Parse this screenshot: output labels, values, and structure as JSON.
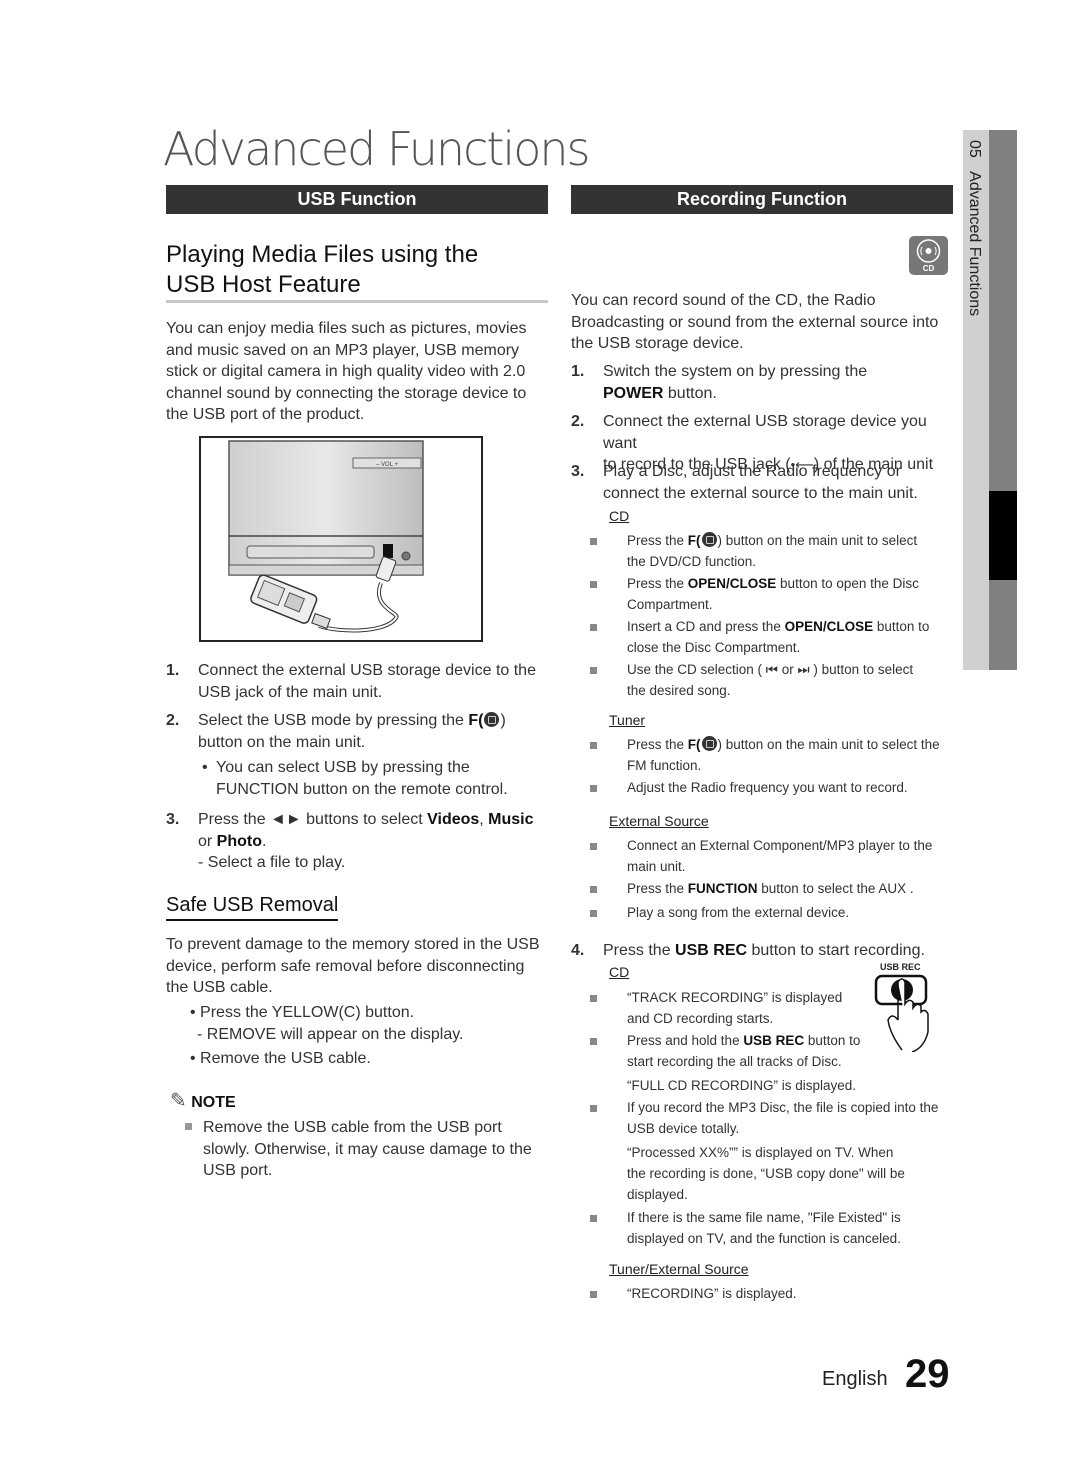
{
  "page_title": "Advanced Functions",
  "usb": {
    "section_label": "USB Function",
    "heading_line1": "Playing Media Files using the",
    "heading_line2": "USB Host Feature",
    "intro": [
      "You can enjoy media files such as pictures, movies",
      "and music saved on an MP3 player, USB memory",
      "stick or digital camera in high quality video with 2.0",
      "channel sound by connecting the storage device to",
      "the USB port of the product."
    ],
    "figure": {
      "vol_label": "–   VOL   +",
      "alt": "Main unit with USB cable connected to an MP3 player"
    },
    "steps": [
      {
        "num": "1.",
        "lines": [
          "Connect the external USB storage device to the",
          "USB jack of the main unit."
        ]
      },
      {
        "num": "2.",
        "line1_pre": "Select the USB mode by pressing the ",
        "line1_bold": "F(",
        "line1_post": ")",
        "line2": "button on the main unit."
      },
      {
        "num": "3.",
        "pre": "Press the ◄► buttons to select ",
        "b1": "Videos",
        "sep": ", ",
        "b2": "Music",
        "line2_pre": "or ",
        "b3": "Photo",
        "line2_post": ".",
        "line3": "- Select a file to play."
      }
    ],
    "step2_bullet": [
      "You can select USB by pressing the",
      "FUNCTION button on the remote control."
    ],
    "safe_removal": {
      "heading": "Safe USB Removal",
      "text": [
        "To prevent damage to the memory stored in the USB",
        "device, perform safe removal before disconnecting",
        "the USB cable."
      ],
      "bullet1": "Press  the YELLOW(C) button.",
      "bullet1_sub": "- REMOVE will appear on the display.",
      "bullet2": "Remove the USB cable."
    },
    "note": {
      "label": "NOTE",
      "lines": [
        "Remove the USB cable from the USB port",
        "slowly. Otherwise, it may cause damage to the",
        "USB port."
      ]
    }
  },
  "recording": {
    "section_label": "Recording Function",
    "cd_badge": "CD",
    "intro": [
      "You can record sound of the CD, the Radio",
      "Broadcasting or sound from the external source into",
      "the USB storage device."
    ],
    "step1": {
      "num": "1.",
      "line1": "Switch the system on by pressing the",
      "bold": "POWER",
      "post": " button."
    },
    "step2": {
      "num": "2.",
      "line1": "Connect the external USB storage device you want",
      "line2_pre": "to record to the USB jack (",
      "line2_post": ") of the main unit"
    },
    "step3": {
      "num": "3.",
      "lines": [
        "Play a Disc, adjust the Radio frequency or",
        "connect the external source to the main unit."
      ]
    },
    "cd_head": "CD",
    "cd_items": [
      {
        "pre": "Press the ",
        "bold": "F(",
        "post": ") button on the main unit to select",
        "line2": "the DVD/CD function."
      },
      {
        "pre": "Press the ",
        "bold": "OPEN/CLOSE",
        "post": "  button to open the Disc",
        "line2": "Compartment."
      },
      {
        "pre": "Insert a CD and press the ",
        "bold": "OPEN/CLOSE",
        "post": "  button to",
        "line2": "close the Disc Compartment."
      },
      {
        "pre": "Use the CD selection ( ⏮ or ⏭ ) button to select",
        "line2": "the desired song."
      }
    ],
    "tuner_head": "Tuner",
    "tuner_items": [
      {
        "pre": "Press the ",
        "bold": "F(",
        "post": ") button on the main unit to select the",
        "line2": "FM function."
      },
      {
        "text": "Adjust the Radio frequency you want to record."
      }
    ],
    "ext_head": "External Source",
    "ext_items": [
      {
        "text": "Connect an External Component/MP3 player to the",
        "line2": "main unit."
      },
      {
        "pre": "Press the ",
        "bold": "FUNCTION",
        "post": "  button to select the AUX ."
      },
      {
        "text": "Play a song from the external device."
      }
    ],
    "step4": {
      "num": "4.",
      "pre": "Press the ",
      "bold": "USB REC",
      "post": " button to start recording."
    },
    "usb_rec_label": "USB REC",
    "cd2_head": "CD",
    "cd2_items": [
      {
        "lines": [
          "“TRACK RECORDING” is displayed",
          "and CD recording starts."
        ]
      },
      {
        "pre": "Press and hold the ",
        "bold": "USB REC",
        "post": " button to",
        "line2": "start recording the all tracks of Disc.",
        "line3": "“FULL CD RECORDING” is displayed."
      },
      {
        "lines": [
          "If you record the MP3 Disc, the file is copied into the",
          "USB device totally."
        ],
        "extra": [
          " “Processed XX%”” is displayed on TV.  When",
          "the recording is done, “USB copy done\" will be",
          "displayed."
        ]
      },
      {
        "lines": [
          "If there is the same file name,  \"File Existed\" is",
          "displayed on TV, and the function is canceled."
        ]
      }
    ],
    "tuner_ext_head": "Tuner/External Source",
    "tuner_ext_items": [
      "“RECORDING” is displayed."
    ]
  },
  "side_tab": {
    "chapter_num": "05",
    "chapter_title": "Advanced Functions"
  },
  "footer": {
    "language": "English",
    "page_number": "29"
  }
}
